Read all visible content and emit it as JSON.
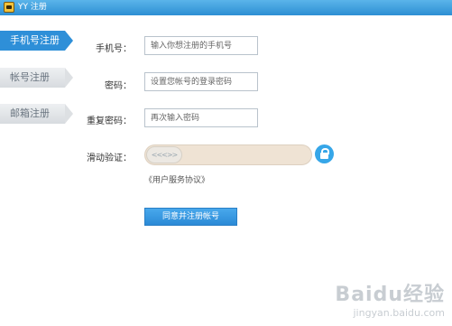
{
  "window": {
    "title": "YY 注册"
  },
  "sidebar": {
    "items": [
      {
        "label": "手机号注册",
        "active": true
      },
      {
        "label": "帐号注册",
        "active": false
      },
      {
        "label": "邮箱注册",
        "active": false
      }
    ]
  },
  "form": {
    "phone": {
      "label": "手机号：",
      "placeholder": "输入你想注册的手机号"
    },
    "password": {
      "label": "密码：",
      "placeholder": "设置您帐号的登录密码"
    },
    "confirm": {
      "label": "重复密码：",
      "placeholder": "再次输入密码"
    },
    "slider": {
      "label": "滑动验证：",
      "handle_text": "<<<>>",
      "progress": 0
    },
    "agreement": "《用户服务协议》",
    "submit": "同意并注册帐号"
  },
  "watermark": {
    "brand": "Baidu经验",
    "url": "jingyan.baidu.com"
  },
  "colors": {
    "accent": "#2e8fd8",
    "titlebar": "#3a9fe0",
    "slider_track": "#efe3d4",
    "lock": "#36a6e8"
  },
  "icons": {
    "lock": "lock-icon",
    "app": "yy-logo-icon"
  }
}
